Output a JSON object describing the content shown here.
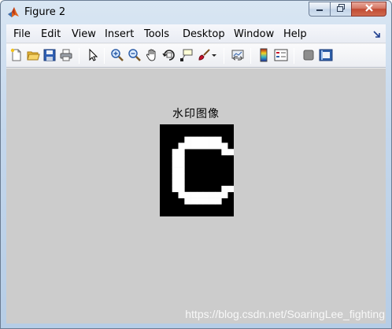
{
  "window": {
    "title": "Figure 2",
    "icon": "matlab-logo-icon"
  },
  "menubar": {
    "items": [
      "File",
      "Edit",
      "View",
      "Insert",
      "Tools",
      "Desktop",
      "Window",
      "Help"
    ]
  },
  "toolbar": {
    "tools": [
      "new-figure-icon",
      "open-file-icon",
      "save-figure-icon",
      "print-figure-icon",
      "edit-plot-arrow-icon",
      "zoom-in-icon",
      "zoom-out-icon",
      "pan-hand-icon",
      "rotate-3d-icon",
      "data-cursor-icon",
      "brush-icon",
      "brush-dropdown-icon",
      "link-plot-icon",
      "insert-colorbar-icon",
      "insert-legend-icon",
      "hide-plot-tools-icon",
      "show-plot-tools-icon"
    ]
  },
  "figure": {
    "background": "#cccccc",
    "axes_title": "水印图像",
    "image": {
      "description_colors": {
        "background": "#000000",
        "glyph": "#ffffff"
      },
      "grid_cols": 12,
      "grid_rows": 15,
      "pixels": [
        "000000000000",
        "000000000000",
        "000011111100",
        "000111111110",
        "001100000011",
        "001100000000",
        "001100000000",
        "001100000000",
        "001100000000",
        "001100000000",
        "001100000011",
        "000111111110",
        "000011111100",
        "000000000000",
        "000000000000"
      ]
    }
  },
  "overlay": {
    "watermark_text": "https://blog.csdn.net/SoaringLee_fighting"
  }
}
